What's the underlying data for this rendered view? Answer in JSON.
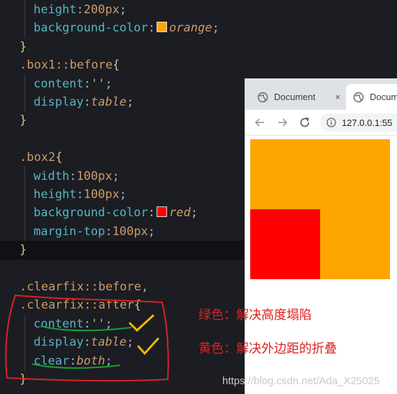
{
  "editor": {
    "lines": [
      {
        "ind": 1,
        "parts": [
          [
            "prop",
            "height"
          ],
          [
            "punc",
            ":"
          ],
          [
            "num",
            "200px"
          ],
          [
            "punc",
            ";"
          ]
        ]
      },
      {
        "ind": 1,
        "parts": [
          [
            "prop",
            "background-color"
          ],
          [
            "punc",
            ":"
          ],
          [
            "swatch",
            "#ffa500"
          ],
          [
            "kw",
            "orange"
          ],
          [
            "punc",
            ";"
          ]
        ]
      },
      {
        "ind": 0,
        "parts": [
          [
            "brace",
            "}"
          ]
        ]
      },
      {
        "ind": 0,
        "parts": [
          [
            "sel",
            ".box1::before"
          ],
          [
            "brace",
            "{"
          ]
        ]
      },
      {
        "ind": 1,
        "parts": [
          [
            "prop",
            "content"
          ],
          [
            "punc",
            ":"
          ],
          [
            "str",
            "''"
          ],
          [
            "punc",
            ";"
          ]
        ]
      },
      {
        "ind": 1,
        "parts": [
          [
            "prop",
            "display"
          ],
          [
            "punc",
            ":"
          ],
          [
            "kw",
            "table"
          ],
          [
            "punc",
            ";"
          ]
        ]
      },
      {
        "ind": 0,
        "parts": [
          [
            "brace",
            "}"
          ]
        ]
      },
      {
        "ind": 0,
        "parts": []
      },
      {
        "ind": 0,
        "parts": [
          [
            "sel",
            ".box2"
          ],
          [
            "brace",
            "{"
          ]
        ]
      },
      {
        "ind": 1,
        "parts": [
          [
            "prop",
            "width"
          ],
          [
            "punc",
            ":"
          ],
          [
            "num",
            "100px"
          ],
          [
            "punc",
            ";"
          ]
        ]
      },
      {
        "ind": 1,
        "parts": [
          [
            "prop",
            "height"
          ],
          [
            "punc",
            ":"
          ],
          [
            "num",
            "100px"
          ],
          [
            "punc",
            ";"
          ]
        ]
      },
      {
        "ind": 1,
        "parts": [
          [
            "prop",
            "background-color"
          ],
          [
            "punc",
            ":"
          ],
          [
            "swatch",
            "#ff0000"
          ],
          [
            "kw",
            "red"
          ],
          [
            "punc",
            ";"
          ]
        ]
      },
      {
        "ind": 1,
        "parts": [
          [
            "prop",
            "margin-top"
          ],
          [
            "punc",
            ":"
          ],
          [
            "num",
            "100px"
          ],
          [
            "punc",
            ";"
          ]
        ]
      },
      {
        "ind": 0,
        "parts": [
          [
            "brace",
            "}"
          ]
        ]
      },
      {
        "ind": 0,
        "parts": []
      },
      {
        "ind": 0,
        "parts": [
          [
            "sel",
            ".clearfix::before"
          ],
          [
            "punc",
            ","
          ]
        ]
      },
      {
        "ind": 0,
        "parts": [
          [
            "sel",
            ".clearfix::after"
          ],
          [
            "brace",
            "{"
          ]
        ]
      },
      {
        "ind": 1,
        "parts": [
          [
            "prop",
            "content"
          ],
          [
            "punc",
            ":"
          ],
          [
            "str",
            "''"
          ],
          [
            "punc",
            ";"
          ]
        ]
      },
      {
        "ind": 1,
        "parts": [
          [
            "prop",
            "display"
          ],
          [
            "punc",
            ":"
          ],
          [
            "kw",
            "table"
          ],
          [
            "punc",
            ";"
          ]
        ]
      },
      {
        "ind": 1,
        "parts": [
          [
            "prop",
            "clear"
          ],
          [
            "punc",
            ":"
          ],
          [
            "kw",
            "both"
          ],
          [
            "punc",
            ";"
          ]
        ]
      },
      {
        "ind": 0,
        "parts": [
          [
            "brace",
            "}"
          ]
        ]
      }
    ]
  },
  "browser": {
    "tabs": [
      {
        "title": "Document",
        "close": "×"
      },
      {
        "title": "Docum"
      }
    ],
    "url": "127.0.0.1:55"
  },
  "annotations": {
    "green_note": "绿色：解决高度塌陷",
    "yellow_note": "黄色：解决外边距的折叠"
  },
  "watermark": "https://blog.csdn.net/Ada_X25025",
  "colors": {
    "editor_bg": "#1b1d23",
    "orange": "#ffa500",
    "red": "#ff0000",
    "annotation_red": "#e02020",
    "annotation_green": "#1aa034",
    "check_yellow": "#f5b800"
  }
}
